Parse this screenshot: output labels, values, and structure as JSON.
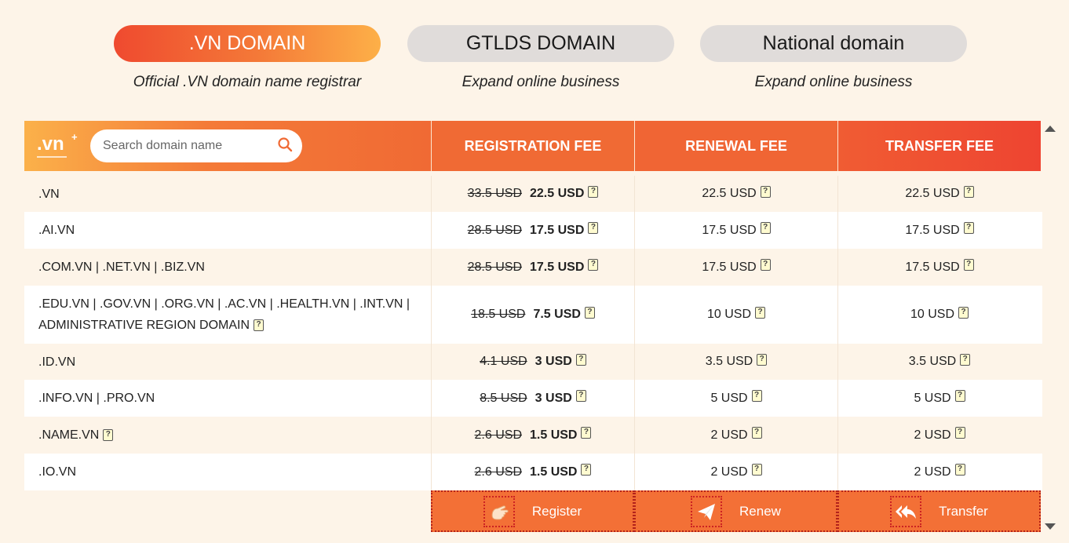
{
  "tabs": [
    {
      "label": ".VN DOMAIN",
      "subtitle": "Official .VN domain name registrar"
    },
    {
      "label": "GTLDS DOMAIN",
      "subtitle": "Expand online business"
    },
    {
      "label": "National domain",
      "subtitle": "Expand online business"
    }
  ],
  "header": {
    "logo": ".vn",
    "logo_sup": "+",
    "search_placeholder": "Search domain name",
    "col_registration": "REGISTRATION FEE",
    "col_renewal": "RENEWAL FEE",
    "col_transfer": "TRANSFER FEE"
  },
  "rows": [
    {
      "name": ".VN",
      "name_note": false,
      "reg_old": "33.5 USD",
      "reg_new": "22.5 USD",
      "renewal": "22.5 USD",
      "transfer": "22.5 USD"
    },
    {
      "name": ".AI.VN",
      "name_note": false,
      "reg_old": "28.5 USD",
      "reg_new": "17.5 USD",
      "renewal": "17.5 USD",
      "transfer": "17.5 USD"
    },
    {
      "name": ".COM.VN | .NET.VN | .BIZ.VN",
      "name_note": false,
      "reg_old": "28.5 USD",
      "reg_new": "17.5 USD",
      "renewal": "17.5 USD",
      "transfer": "17.5 USD"
    },
    {
      "name": ".EDU.VN | .GOV.VN | .ORG.VN | .AC.VN | .HEALTH.VN | .INT.VN | ADMINISTRATIVE REGION DOMAIN",
      "name_note": true,
      "reg_old": "18.5 USD",
      "reg_new": "7.5 USD",
      "renewal": "10 USD",
      "transfer": "10 USD"
    },
    {
      "name": ".ID.VN",
      "name_note": false,
      "reg_old": "4.1 USD",
      "reg_new": "3 USD",
      "renewal": "3.5 USD",
      "transfer": "3.5 USD"
    },
    {
      "name": ".INFO.VN | .PRO.VN",
      "name_note": false,
      "reg_old": "8.5 USD",
      "reg_new": "3 USD",
      "renewal": "5 USD",
      "transfer": "5 USD"
    },
    {
      "name": ".NAME.VN",
      "name_note": true,
      "reg_old": "2.6 USD",
      "reg_new": "1.5 USD",
      "renewal": "2 USD",
      "transfer": "2 USD"
    },
    {
      "name": ".IO.VN",
      "name_note": false,
      "reg_old": "2.6 USD",
      "reg_new": "1.5 USD",
      "renewal": "2 USD",
      "transfer": "2 USD"
    }
  ],
  "actions": {
    "register": "Register",
    "renew": "Renew",
    "transfer": "Transfer"
  },
  "icons": {
    "note": "note-icon",
    "search": "search-icon",
    "register": "hand-pointer-icon",
    "renew": "paper-plane-icon",
    "transfer": "reply-all-icon"
  },
  "colors": {
    "accent": "#f37036",
    "background": "#fdf4e8",
    "tab_inactive": "#e0dcda"
  }
}
